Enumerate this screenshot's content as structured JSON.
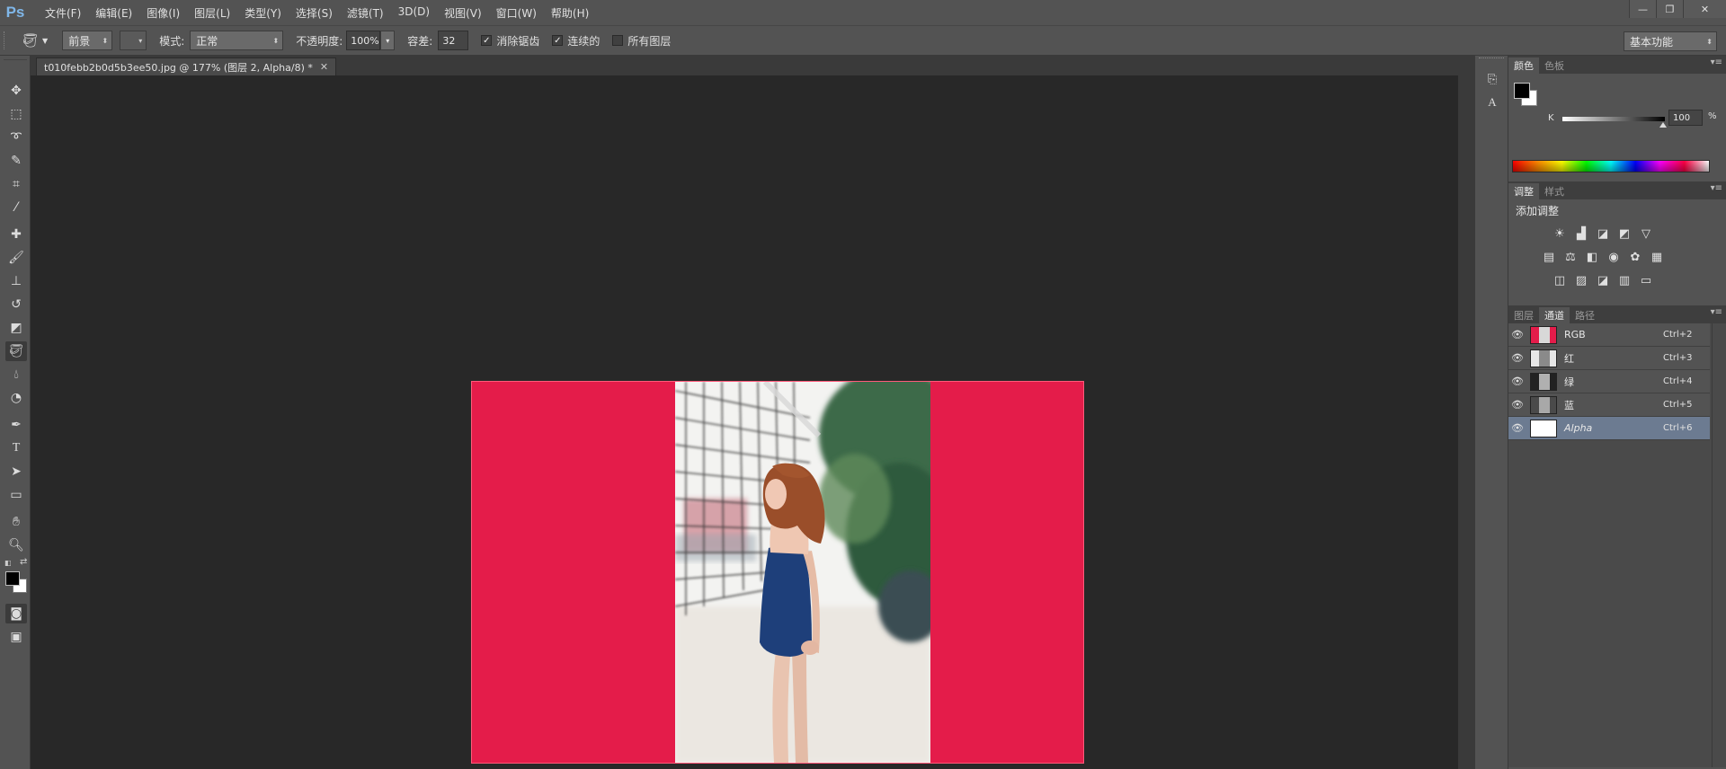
{
  "app": {
    "logo": "Ps"
  },
  "menu": [
    "文件(F)",
    "编辑(E)",
    "图像(I)",
    "图层(L)",
    "类型(Y)",
    "选择(S)",
    "滤镜(T)",
    "3D(D)",
    "视图(V)",
    "窗口(W)",
    "帮助(H)"
  ],
  "window_controls": {
    "minimize": "—",
    "restore": "❐",
    "close": "✕"
  },
  "options": {
    "fill_source": "前景",
    "mode_label": "模式:",
    "mode_value": "正常",
    "opacity_label": "不透明度:",
    "opacity_value": "100%",
    "tolerance_label": "容差:",
    "tolerance_value": "32",
    "antialias_label": "消除锯齿",
    "antialias_checked": true,
    "contiguous_label": "连续的",
    "contiguous_checked": true,
    "all_layers_label": "所有图层",
    "all_layers_checked": false,
    "workspace": "基本功能"
  },
  "document": {
    "tab_title": "t010febb2b0d5b3ee50.jpg @ 177% (图层 2, Alpha/8) *",
    "close": "✕",
    "background_color": "#e41c4a"
  },
  "tools": [
    "move-tool",
    "marquee-tool",
    "lasso-tool",
    "quick-select-tool",
    "crop-tool",
    "eyedropper-tool",
    "healing-brush-tool",
    "brush-tool",
    "clone-stamp-tool",
    "history-brush-tool",
    "eraser-tool",
    "paint-bucket-tool",
    "blur-tool",
    "dodge-tool",
    "pen-tool",
    "type-tool",
    "path-select-tool",
    "shape-tool",
    "hand-tool",
    "zoom-tool"
  ],
  "color_panel": {
    "tabs": [
      "颜色",
      "色板"
    ],
    "channel": "K",
    "value": "100",
    "unit": "%",
    "foreground": "#000000",
    "background": "#ffffff"
  },
  "adjustments_panel": {
    "tabs": [
      "调整",
      "样式"
    ],
    "title": "添加调整"
  },
  "channels_panel": {
    "tabs": [
      "图层",
      "通道",
      "路径"
    ],
    "channels": [
      {
        "name": "RGB",
        "shortcut": "Ctrl+2"
      },
      {
        "name": "红",
        "shortcut": "Ctrl+3"
      },
      {
        "name": "绿",
        "shortcut": "Ctrl+4"
      },
      {
        "name": "蓝",
        "shortcut": "Ctrl+5"
      },
      {
        "name": "Alpha",
        "shortcut": "Ctrl+6"
      }
    ]
  }
}
